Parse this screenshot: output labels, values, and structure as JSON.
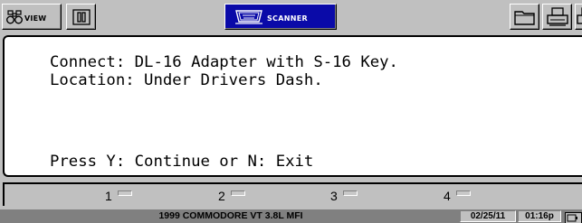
{
  "toolbar": {
    "view_label": "VIEW",
    "scanner_label": "SCANNER",
    "icons": {
      "view": "binoculars-icon",
      "pause": "pause-icon",
      "scanner": "connector-icon",
      "folder": "folder-icon",
      "print": "printer-icon"
    }
  },
  "message": {
    "line1": "Connect: DL-16 Adapter with S-16 Key.",
    "line2": "Location: Under Drivers Dash.",
    "line3": "Press Y: Continue or N: Exit"
  },
  "function_keys": [
    {
      "label": "1"
    },
    {
      "label": "2"
    },
    {
      "label": "3"
    },
    {
      "label": "4"
    }
  ],
  "status": {
    "vehicle": "1999 COMMODORE VT 3.8L MFI",
    "date": "02/25/11",
    "time": "01:16p"
  },
  "colors": {
    "accent": "#0a0aa8",
    "background": "#c0c0c0",
    "panel": "#ffffff",
    "statusbar": "#808080"
  }
}
